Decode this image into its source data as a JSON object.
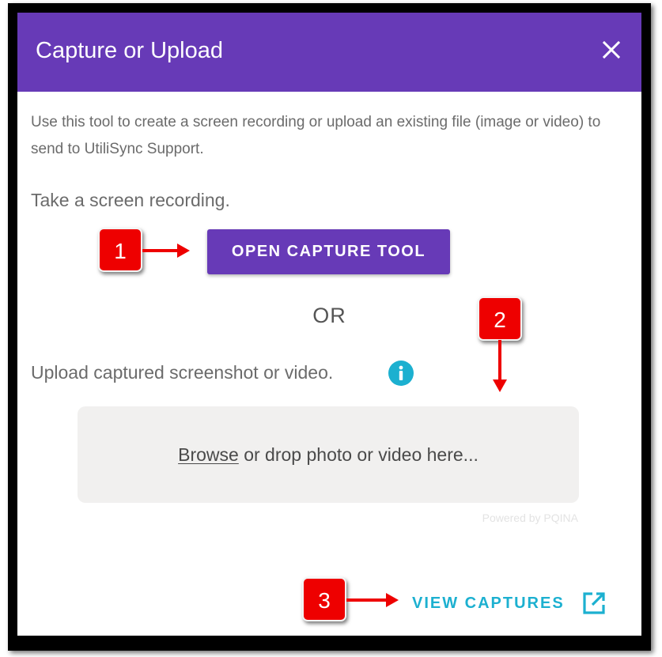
{
  "dialog": {
    "title": "Capture or Upload",
    "description": "Use this tool to create a screen recording or upload an existing file (image or video) to send to UtiliSync Support.",
    "take_label": "Take a screen recording.",
    "capture_button_label": "OPEN CAPTURE TOOL",
    "or_text": "OR",
    "upload_label": "Upload captured screenshot or video.",
    "dropzone": {
      "browse_label": "Browse",
      "rest_label": " or drop photo or video here..."
    },
    "powered_by": "Powered by PQINA",
    "view_captures_label": "VIEW CAPTURES"
  },
  "callouts": {
    "one": "1",
    "two": "2",
    "three": "3"
  },
  "icons": {
    "close": "close-icon",
    "info": "info-icon",
    "external_link": "open-in-new-icon"
  },
  "colors": {
    "header": "#673ab7",
    "primary_button": "#673ab7",
    "accent_link": "#1cb0d0",
    "callout": "#ee0000",
    "dropzone": "#f1f0ef"
  }
}
